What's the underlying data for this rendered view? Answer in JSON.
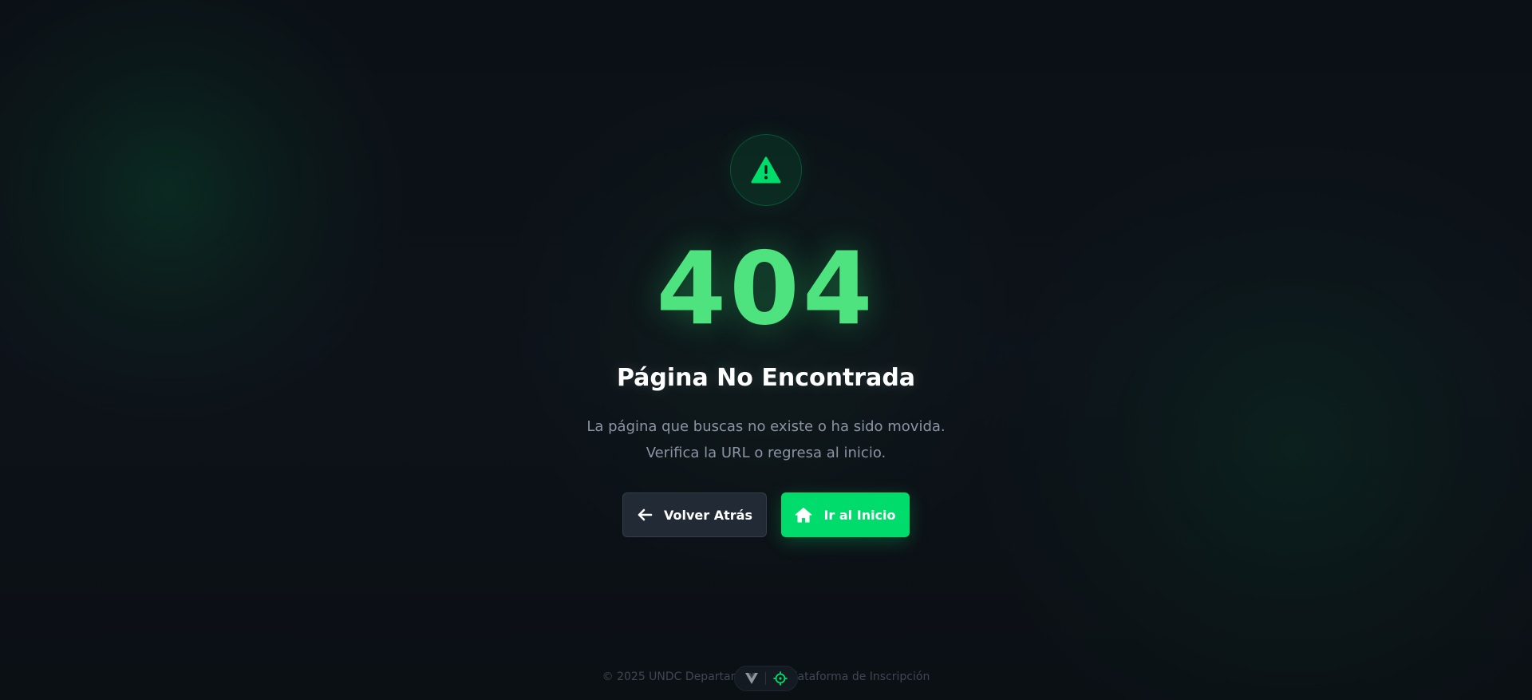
{
  "error": {
    "icon": "warning-triangle-icon",
    "code": "404",
    "title": "Página No Encontrada",
    "description_line1": "La página que buscas no existe o ha sido movida.",
    "description_line2": "Verifica la URL o regresa al inicio."
  },
  "actions": {
    "back_label": "Volver Atrás",
    "back_icon": "arrow-left-icon",
    "home_label": "Ir al Inicio",
    "home_icon": "home-icon"
  },
  "footer": {
    "text": "© 2025 UNDC Departamento de Plataforma de Inscripción"
  },
  "devtools": {
    "icons": [
      "vue-logo-icon",
      "crosshair-icon"
    ]
  },
  "colors": {
    "accent": "#00dc6c",
    "code_text": "#4ee37f",
    "background": "#0c1118",
    "secondary_button": "#222a35"
  }
}
